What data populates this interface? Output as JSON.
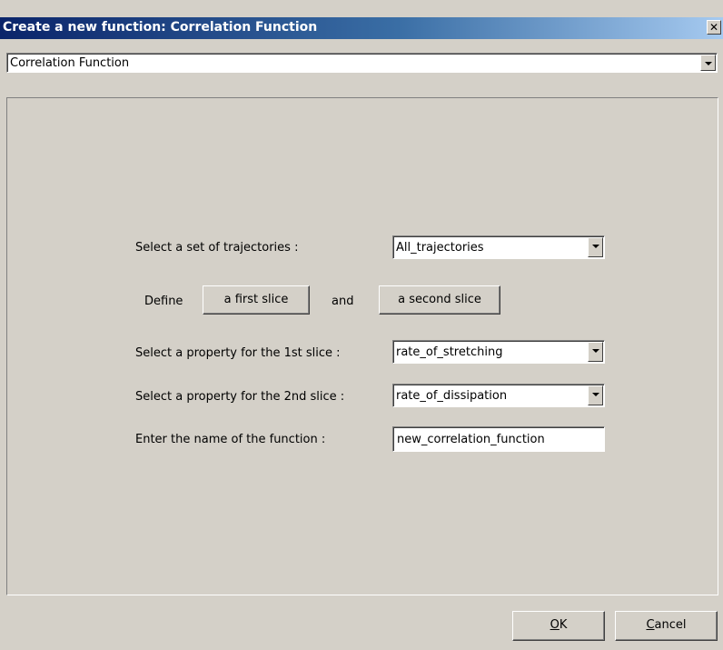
{
  "window": {
    "title": "Create a new function: Correlation Function",
    "close_glyph": "✕"
  },
  "function_type": {
    "selected": "Correlation Function"
  },
  "form": {
    "trajectories_label": "Select a set of trajectories :",
    "trajectories_value": "All_trajectories",
    "define_label": "Define",
    "first_slice_button": "a first slice",
    "and_label": "and",
    "second_slice_button": "a second slice",
    "property1_label": "Select a property for the 1st slice :",
    "property1_value": "rate_of_stretching",
    "property2_label": "Select a property for the 2nd slice :",
    "property2_value": "rate_of_dissipation",
    "name_label": "Enter the name of the function :",
    "name_value": "new_correlation_function"
  },
  "footer": {
    "ok_mnemonic": "O",
    "ok_rest": "K",
    "cancel_mnemonic": "C",
    "cancel_rest": "ancel"
  }
}
